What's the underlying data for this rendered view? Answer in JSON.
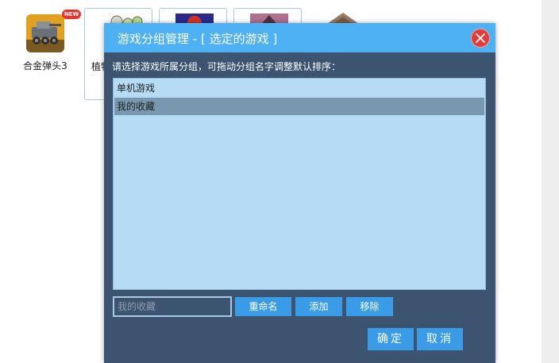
{
  "background_games": [
    {
      "label": "合金弹头3",
      "badge": "NEW"
    },
    {
      "label": "植物"
    }
  ],
  "dialog": {
    "title": "游戏分组管理 - [ 选定的游戏 ]",
    "instruction": "请选择游戏所属分组，可拖动分组名字调整默认排序：",
    "groups": [
      {
        "label": "单机游戏",
        "selected": false
      },
      {
        "label": "我的收藏",
        "selected": true
      }
    ],
    "name_input": {
      "value": "",
      "placeholder": "我的收藏"
    },
    "rename_label": "重命名",
    "add_label": "添加",
    "remove_label": "移除",
    "confirm_label": "确定",
    "cancel_label": "取消"
  },
  "colors": {
    "header": "#4db1f4",
    "dialog_body": "#3c5470",
    "list_bg": "#b5dcf4",
    "selected_row": "#7898b0",
    "button": "#3a9ce6",
    "close": "#e23b3b",
    "new_badge": "#e8332b"
  }
}
